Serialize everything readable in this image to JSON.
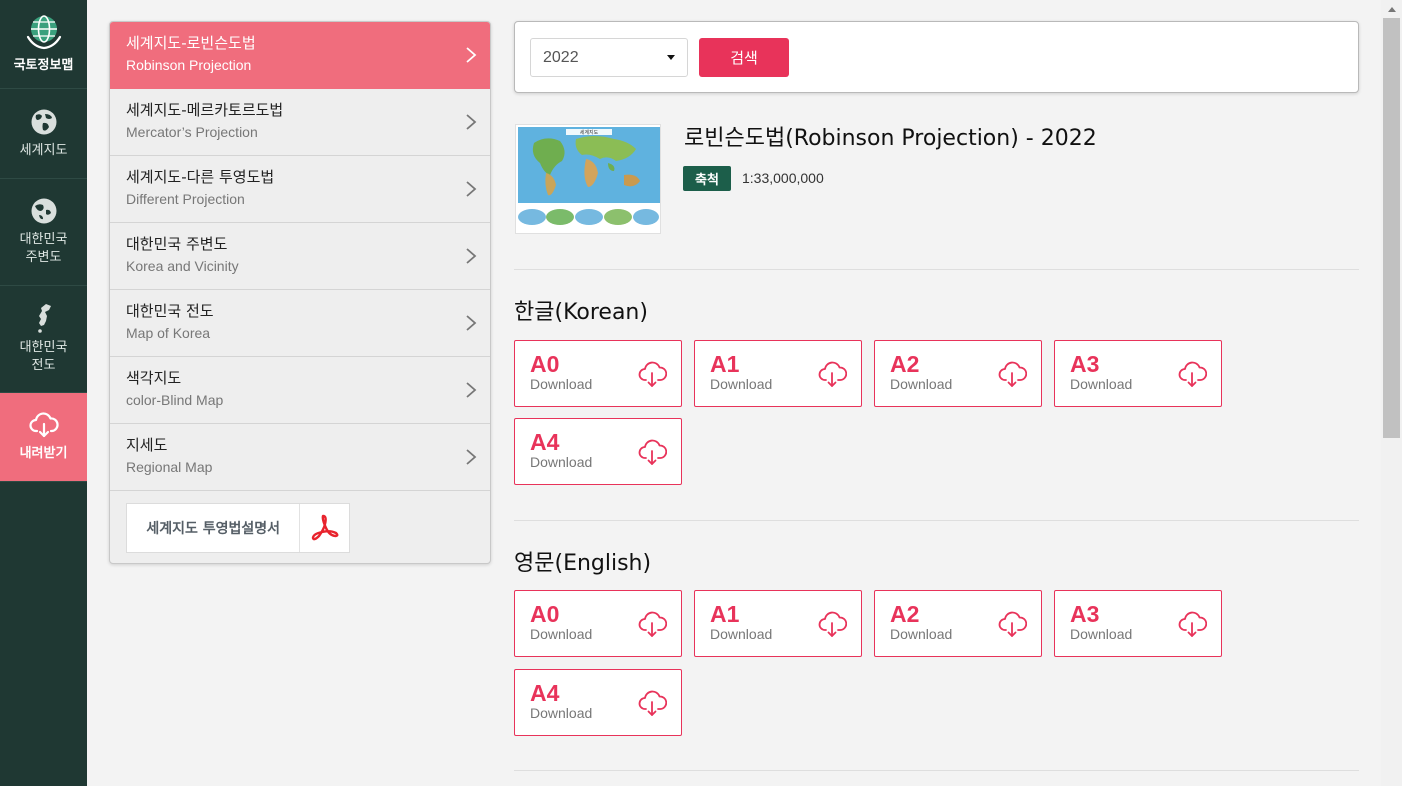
{
  "rail": {
    "brand": {
      "label": "국토정보맵",
      "icon": "globe-hands-icon"
    },
    "items": [
      {
        "label": "세계지도",
        "icon": "world-globe-icon"
      },
      {
        "label": "대한민국\n주변도",
        "icon": "asia-globe-icon"
      },
      {
        "label": "대한민국\n전도",
        "icon": "korea-peninsula-icon"
      },
      {
        "label": "내려받기",
        "icon": "cloud-download-icon",
        "active": true
      }
    ]
  },
  "menu": {
    "items": [
      {
        "ko": "세계지도-로빈슨도법",
        "en": "Robinson Projection",
        "active": true
      },
      {
        "ko": "세계지도-메르카토르도법",
        "en": "Mercator’s Projection"
      },
      {
        "ko": "세계지도-다른 투영도법",
        "en": "Different Projection"
      },
      {
        "ko": "대한민국 주변도",
        "en": "Korea and Vicinity"
      },
      {
        "ko": "대한민국 전도",
        "en": "Map of Korea"
      },
      {
        "ko": "색각지도",
        "en": "color-Blind Map"
      },
      {
        "ko": "지세도",
        "en": "Regional Map"
      }
    ],
    "pdf_button": "세계지도 투영법설명서"
  },
  "search": {
    "year": "2022",
    "button": "검색"
  },
  "map": {
    "title": "로빈슨도법(Robinson Projection) - 2022",
    "thumb_title": "세계지도",
    "scale_label": "축척",
    "scale_value": "1:33,000,000"
  },
  "sections": [
    {
      "title": "한글(Korean)",
      "buttons": [
        {
          "size": "A0",
          "sub": "Download"
        },
        {
          "size": "A1",
          "sub": "Download"
        },
        {
          "size": "A2",
          "sub": "Download"
        },
        {
          "size": "A3",
          "sub": "Download"
        },
        {
          "size": "A4",
          "sub": "Download"
        }
      ]
    },
    {
      "title": "영문(English)",
      "buttons": [
        {
          "size": "A0",
          "sub": "Download"
        },
        {
          "size": "A1",
          "sub": "Download"
        },
        {
          "size": "A2",
          "sub": "Download"
        },
        {
          "size": "A3",
          "sub": "Download"
        },
        {
          "size": "A4",
          "sub": "Download"
        }
      ]
    }
  ],
  "colors": {
    "rail_bg": "#1f3833",
    "accent_pink": "#f06d7d",
    "accent_red": "#e8335a",
    "badge_green": "#1c5e4a"
  }
}
